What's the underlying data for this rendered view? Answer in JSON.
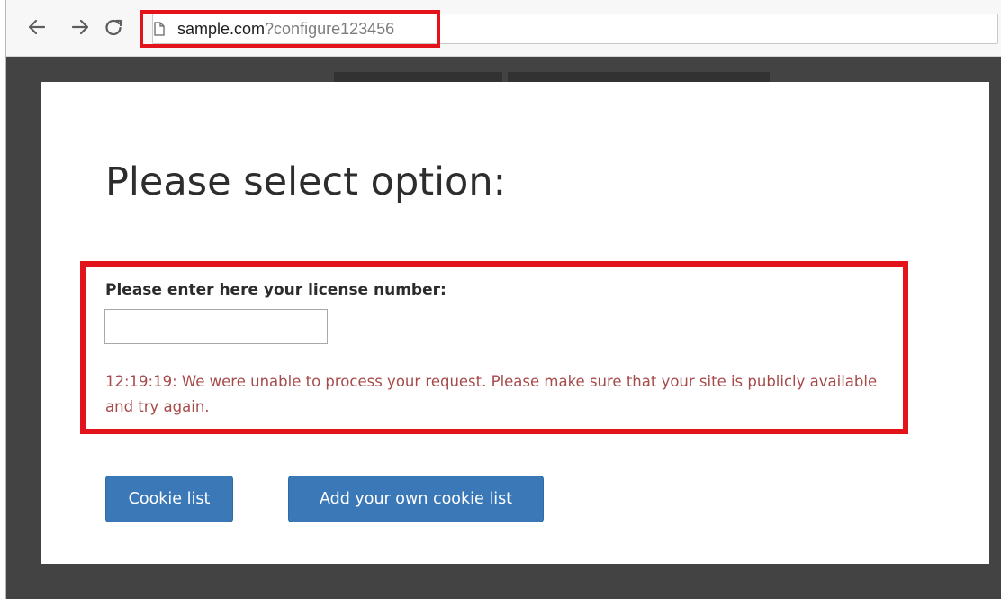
{
  "browser": {
    "url_host": "sample.com",
    "url_path": "?configure123456",
    "icons": {
      "back": "arrow-left-icon",
      "forward": "arrow-right-icon",
      "reload": "reload-icon",
      "page": "page-icon"
    }
  },
  "page": {
    "title": "Please select option:",
    "license": {
      "label": "Please enter here your license number:",
      "value": "",
      "placeholder": ""
    },
    "error_message": "12:19:19: We were unable to process your request. Please make sure that your site is publicly available and try again.",
    "buttons": {
      "cookie_list": "Cookie list",
      "add_cookie_list": "Add your own cookie list"
    }
  },
  "colors": {
    "highlight": "#e3131b",
    "button": "#3b78b8",
    "error_text": "#a64a4a",
    "viewport_bg": "#434343"
  }
}
